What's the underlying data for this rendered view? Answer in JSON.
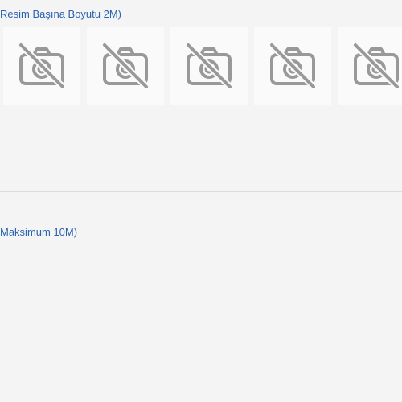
{
  "images_section": {
    "title": "Resim Başına Boyutu 2M)",
    "placeholder_icon": "no-photo-icon",
    "slots": [
      {
        "icon": "no-photo-icon"
      },
      {
        "icon": "no-photo-icon"
      },
      {
        "icon": "no-photo-icon"
      },
      {
        "icon": "no-photo-icon"
      },
      {
        "icon": "no-photo-icon"
      }
    ]
  },
  "files_section": {
    "title": "Maksimum 10M)"
  },
  "colors": {
    "accent": "#2a63b0",
    "background": "#f4f4f4",
    "thumb_background": "#fafafa",
    "divider": "#dcdcdc",
    "icon": "#999999"
  }
}
